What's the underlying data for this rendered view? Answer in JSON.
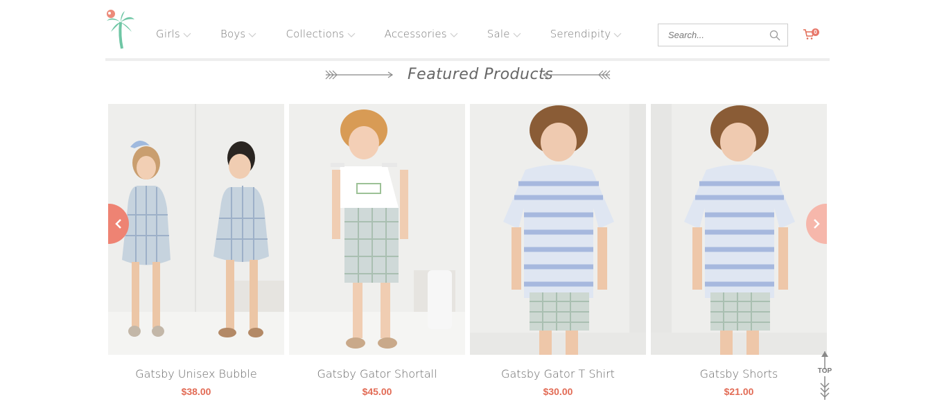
{
  "nav": {
    "items": [
      {
        "label": "Girls"
      },
      {
        "label": "Boys"
      },
      {
        "label": "Collections"
      },
      {
        "label": "Accessories"
      },
      {
        "label": "Sale"
      },
      {
        "label": "Serendipity"
      }
    ]
  },
  "search": {
    "placeholder": "Search..."
  },
  "cart": {
    "count": "0"
  },
  "section": {
    "title": "Featured Products"
  },
  "products": [
    {
      "name": "Gatsby Unisex Bubble",
      "price": "$38.00"
    },
    {
      "name": "Gatsby Gator Shortall",
      "price": "$45.00"
    },
    {
      "name": "Gatsby Gator T Shirt",
      "price": "$30.00"
    },
    {
      "name": "Gatsby Shorts",
      "price": "$21.00"
    }
  ],
  "top_button": {
    "label": "TOP"
  },
  "colors": {
    "accent": "#e26b55",
    "palm": "#6fc6a5",
    "carousel": "#ee8373"
  }
}
